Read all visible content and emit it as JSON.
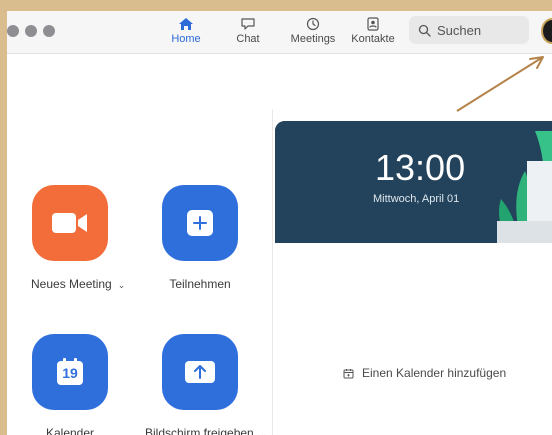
{
  "nav": {
    "tabs": [
      {
        "label": "Home",
        "icon": "home-icon",
        "active": true
      },
      {
        "label": "Chat",
        "icon": "chat-icon",
        "active": false
      },
      {
        "label": "Meetings",
        "icon": "clock-icon",
        "active": false
      },
      {
        "label": "Kontakte",
        "icon": "contacts-icon",
        "active": false
      }
    ],
    "search_placeholder": "Suchen"
  },
  "actions": [
    {
      "label": "Neues Meeting",
      "icon": "video-camera-icon",
      "color": "#f26d3a",
      "has_dropdown": true
    },
    {
      "label": "Teilnehmen",
      "icon": "plus-icon",
      "color": "#2f6fdc",
      "has_dropdown": false
    },
    {
      "label": "Kalender",
      "icon": "calendar-icon",
      "color": "#2f6fdc",
      "calendar_day": "19",
      "has_dropdown": false
    },
    {
      "label": "Bildschirm freigeben",
      "icon": "share-screen-icon",
      "color": "#2f6fdc",
      "has_dropdown": true
    }
  ],
  "clock": {
    "time": "13:00",
    "date": "Mittwoch, April 01"
  },
  "calendar": {
    "add_label": "Einen Kalender hinzufügen"
  },
  "colors": {
    "accent": "#2d6bd8",
    "orange": "#f26d3a",
    "blue": "#2f6fdc",
    "clock_bg": "#1e3d55",
    "frame": "#d9bd8e",
    "annotation_arrow": "#b5834a"
  }
}
